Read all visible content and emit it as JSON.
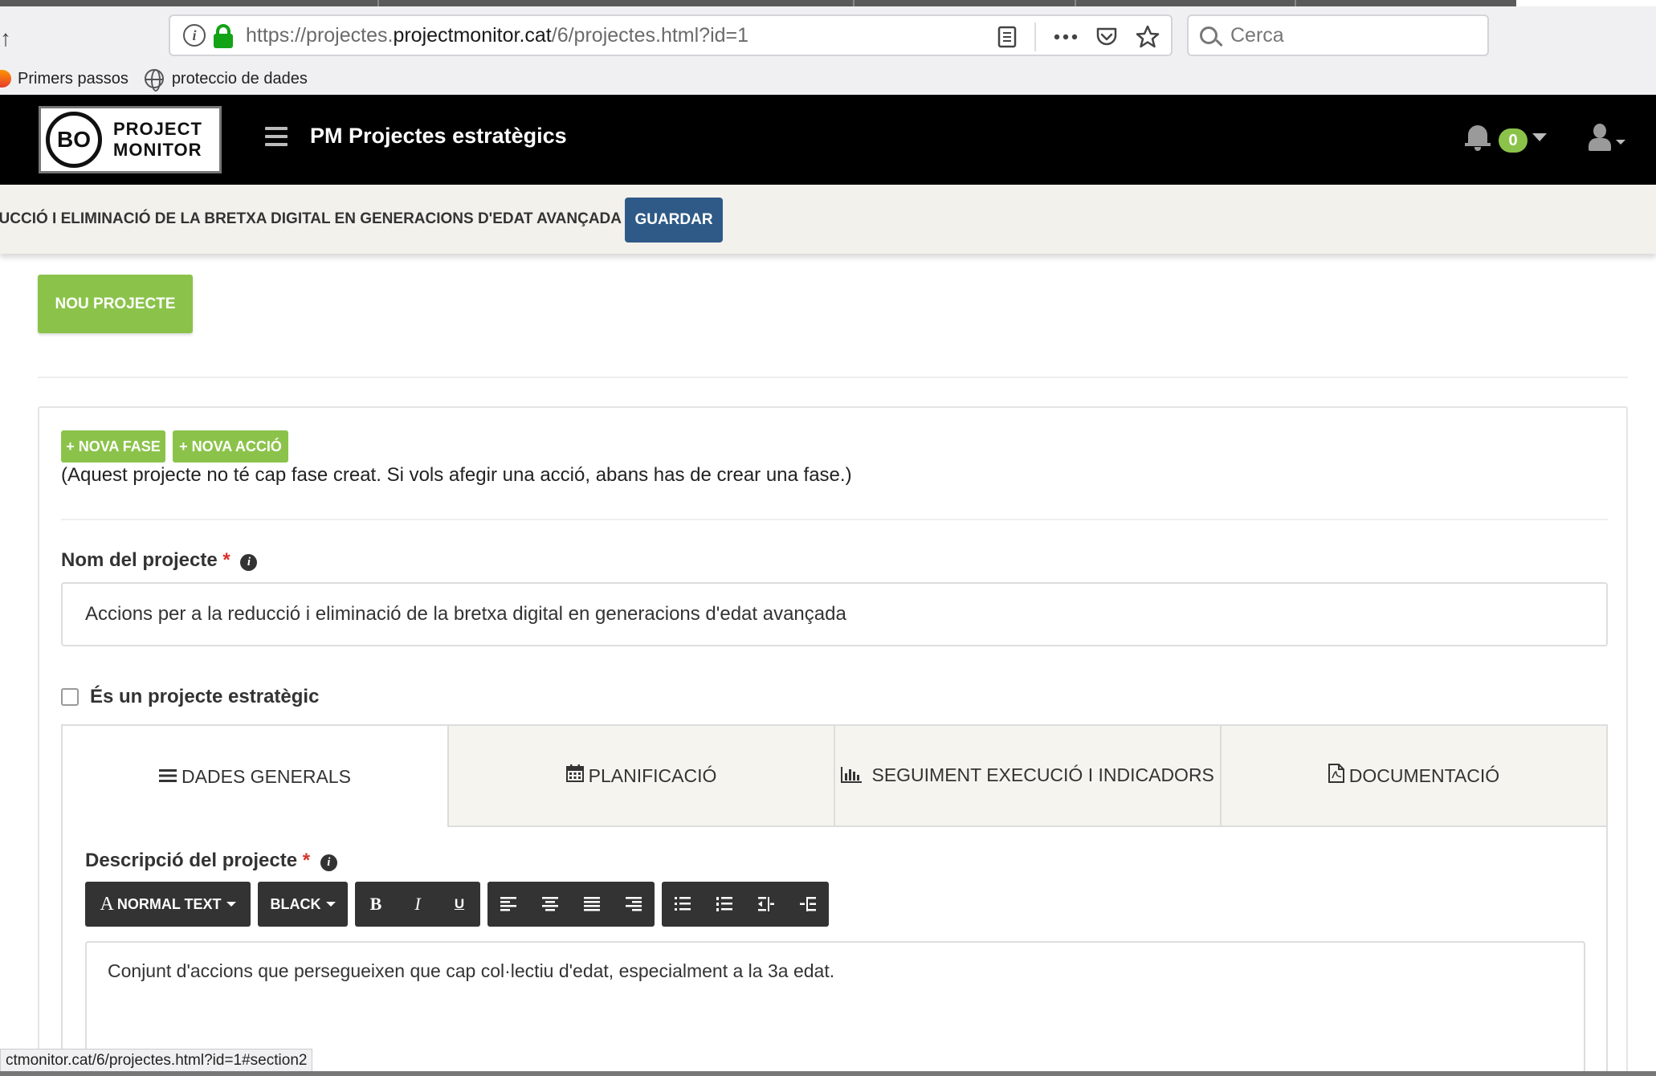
{
  "browser": {
    "url_prefix": "https://projectes.",
    "url_host": "projectmonitor.cat",
    "url_path": "/6/projectes.html?id=1",
    "search_placeholder": "Cerca",
    "bookmarks": [
      {
        "label": "Primers passos",
        "icon": "firefox-icon"
      },
      {
        "label": "proteccio de dades",
        "icon": "globe-icon"
      }
    ],
    "status_url": "ctmonitor.cat/6/projectes.html?id=1#section2"
  },
  "header": {
    "logo_mark": "BO",
    "logo_line1": "PROJECT",
    "logo_line2": "MONITOR",
    "title": "PM Projectes estratègics",
    "notification_count": "0"
  },
  "save_bar": {
    "project_title": "REDUCCIÓ I ELIMINACIÓ DE LA BRETXA DIGITAL EN GENERACIONS D'EDAT AVANÇADA",
    "save_label": "GUARDAR"
  },
  "main": {
    "new_project_label": "NOU PROJECTE",
    "new_phase_label": "+ NOVA FASE",
    "new_action_label": "+ NOVA ACCIÓ",
    "no_phase_note": "(Aquest projecte no té cap fase creat. Si vols afegir una acció, abans has de crear una fase.)",
    "name_label": "Nom del projecte",
    "required_mark": "*",
    "name_value": "Accions per a la reducció i eliminació de la bretxa digital en generacions d'edat avançada",
    "strategic_label": "És un projecte estratègic",
    "strategic_checked": false,
    "tabs": [
      {
        "label": "DADES GENERALS",
        "icon": "list-icon",
        "active": true
      },
      {
        "label": "PLANIFICACIÓ",
        "icon": "calendar-icon",
        "active": false
      },
      {
        "label": "SEGUIMENT EXECUCIÓ I INDICADORS",
        "icon": "bar-chart-icon",
        "active": false
      },
      {
        "label": "DOCUMENTACIÓ",
        "icon": "pdf-file-icon",
        "active": false
      }
    ],
    "description_label": "Descripció del projecte",
    "editor": {
      "style_dropdown": "NORMAL TEXT",
      "color_dropdown": "BLACK",
      "bold": "B",
      "italic": "I",
      "underline": "U"
    },
    "description_value": "Conjunt d'accions que persegueixen que cap col·lectiu d'edat, especialment a la 3a edat."
  },
  "colors": {
    "header_bg": "#000000",
    "accent_green": "#8bc34a",
    "save_blue": "#2f5a87",
    "required_red": "#d9312b"
  }
}
